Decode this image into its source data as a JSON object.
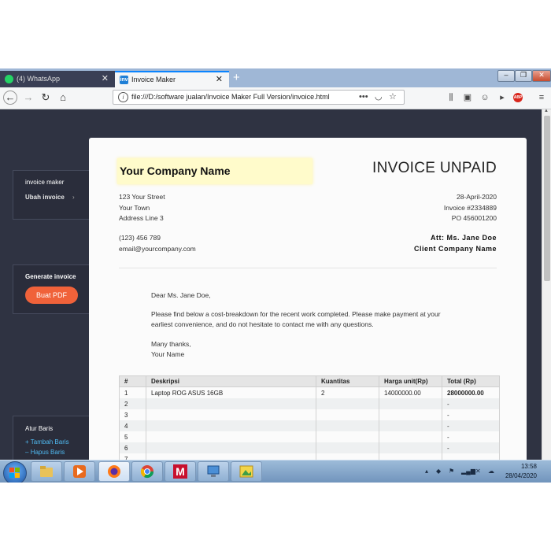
{
  "browser": {
    "tabs": [
      {
        "title": "(4) WhatsApp",
        "icon": "whatsapp-icon"
      },
      {
        "title": "Invoice Maker",
        "icon": "invoice-maker-favicon",
        "favicon_text": "inv"
      }
    ],
    "new_tab": "+",
    "url": "file:///D:/software jualan/Invoice Maker Full Version/invoice.html",
    "url_dots": "•••",
    "abp_label": "ABP"
  },
  "sidebar": {
    "menu": {
      "title": "invoice maker",
      "link": "Ubah invoice",
      "chevron": "›"
    },
    "generate": {
      "title": "Generate invoice",
      "button": "Buat PDF"
    },
    "rows": {
      "title": "Atur Baris",
      "add": "Tambah Baris",
      "remove": "Hapus Baris",
      "add_sym": "+",
      "remove_sym": "–"
    }
  },
  "invoice": {
    "company_name": "Your Company Name",
    "status": "INVOICE UNPAID",
    "address": [
      "123 Your Street",
      "Your Town",
      "Address Line 3"
    ],
    "phone": "(123) 456 789",
    "email": "email@yourcompany.com",
    "date": "28-April-2020",
    "number": "Invoice #2334889",
    "po": "PO 456001200",
    "attention": "Att: Ms. Jane Doe",
    "client": "Client Company Name",
    "letter": {
      "greeting": "Dear Ms. Jane Doe,",
      "body": "Please find below a cost-breakdown for the recent work completed. Please make payment at your earliest convenience, and do not hesitate to contact me with any questions.",
      "closing": "Many thanks,",
      "signature": "Your Name"
    },
    "table": {
      "headers": [
        "#",
        "Deskripsi",
        "Kuantitas",
        "Harga unit(Rp)",
        "Total (Rp)"
      ],
      "rows": [
        [
          "1",
          "Laptop ROG ASUS 16GB",
          "2",
          "14000000.00",
          "28000000.00"
        ],
        [
          "2",
          "",
          "",
          "",
          "-"
        ],
        [
          "3",
          "",
          "",
          "",
          "-"
        ],
        [
          "4",
          "",
          "",
          "",
          "-"
        ],
        [
          "5",
          "",
          "",
          "",
          "-"
        ],
        [
          "6",
          "",
          "",
          "",
          "-"
        ],
        [
          "7",
          "",
          "",
          "",
          ""
        ]
      ]
    }
  },
  "taskbar": {
    "apps": [
      "explorer-icon",
      "media-player-icon",
      "firefox-icon",
      "chrome-icon",
      "mcafee-icon",
      "remote-desktop-icon",
      "photo-viewer-icon"
    ],
    "mcafee_letter": "M",
    "time": "13:58",
    "date": "28/04/2020"
  },
  "colors": {
    "sidebar_bg": "#2f3342",
    "accent_button": "#f0623a",
    "link_blue": "#4fb8ef",
    "company_highlight": "#fffbcb"
  }
}
